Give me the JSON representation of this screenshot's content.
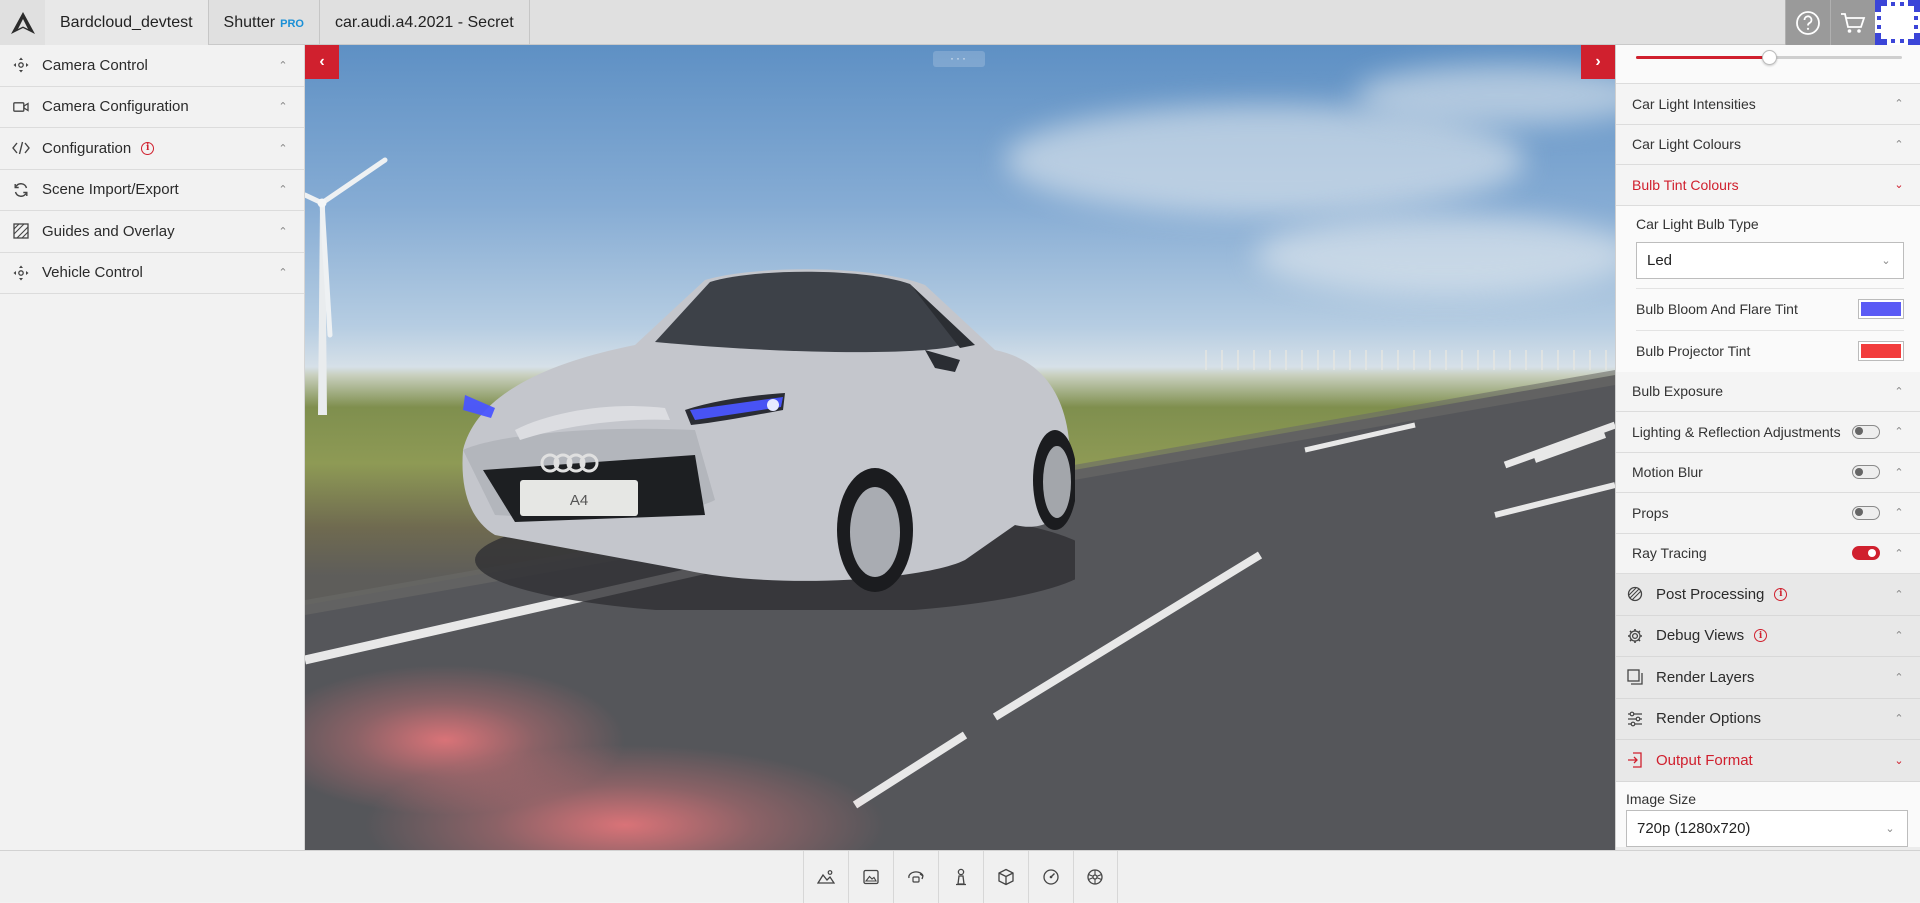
{
  "header": {
    "tabs": [
      {
        "label": "Bardcloud_devtest"
      },
      {
        "label": "Shutter",
        "badge": "PRO"
      },
      {
        "label": "car.audi.a4.2021 - Secret"
      }
    ],
    "icons": [
      "help-icon",
      "cart-icon",
      "avatar"
    ]
  },
  "left_menu": {
    "items": [
      {
        "label": "Camera Control",
        "icon": "camera-control-icon"
      },
      {
        "label": "Camera Configuration",
        "icon": "video-camera-icon"
      },
      {
        "label": "Configuration",
        "icon": "code-icon",
        "info": true
      },
      {
        "label": "Scene Import/Export",
        "icon": "sync-icon"
      },
      {
        "label": "Guides and Overlay",
        "icon": "overlay-icon"
      },
      {
        "label": "Vehicle Control",
        "icon": "vehicle-control-icon"
      }
    ]
  },
  "viewport": {
    "plate_text": "A4",
    "prev_label": "‹",
    "next_label": "›",
    "drag_handle": "···"
  },
  "right_panel": {
    "slider": {
      "value_fraction": 0.5
    },
    "items_top": [
      {
        "label": "Car Light Intensities"
      },
      {
        "label": "Car Light Colours"
      }
    ],
    "bulb_tint": {
      "label": "Bulb Tint Colours",
      "bulb_type_label": "Car Light Bulb Type",
      "bulb_type_value": "Led",
      "bloom_label": "Bulb Bloom And Flare Tint",
      "bloom_color": "#5b5bf5",
      "projector_label": "Bulb Projector Tint",
      "projector_color": "#f23c3c"
    },
    "items_mid": [
      {
        "label": "Bulb Exposure",
        "toggle": null
      },
      {
        "label": "Lighting & Reflection Adjustments",
        "toggle": false
      },
      {
        "label": "Motion Blur",
        "toggle": false
      },
      {
        "label": "Props",
        "toggle": false
      },
      {
        "label": "Ray Tracing",
        "toggle": true
      }
    ],
    "sections": [
      {
        "label": "Post Processing",
        "icon": "post-processing-icon",
        "info": true
      },
      {
        "label": "Debug Views",
        "icon": "gear-icon",
        "info": true
      },
      {
        "label": "Render Layers",
        "icon": "layers-icon"
      },
      {
        "label": "Render Options",
        "icon": "sliders-icon"
      }
    ],
    "output_format": {
      "label": "Output Format",
      "image_size_label": "Image Size",
      "image_size_value": "720p (1280x720)"
    }
  },
  "bottom_toolbar": {
    "buttons": [
      "landscape-icon",
      "image-frame-icon",
      "rotate-camera-icon",
      "chess-piece-icon",
      "cube-icon",
      "gauge-icon",
      "wheel-icon"
    ]
  },
  "colors": {
    "accent": "#d0202e",
    "pro": "#1a8fd6"
  }
}
